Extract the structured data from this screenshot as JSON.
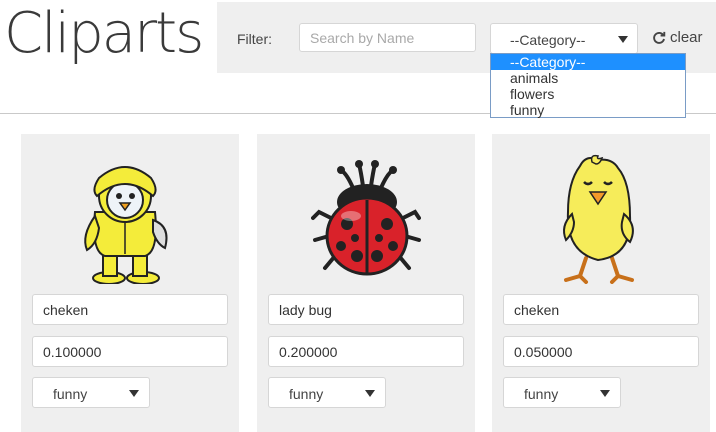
{
  "header": {
    "title": "Cliparts"
  },
  "filter": {
    "label": "Filter:",
    "search_placeholder": "Search by Name",
    "category_value": "--Category--",
    "clear_label": "clear"
  },
  "category_dropdown": {
    "options": [
      "--Category--",
      "animals",
      "flowers",
      "funny"
    ],
    "selected_index": 0
  },
  "cliparts": [
    {
      "icon": "chick-raincoat-icon",
      "name": "cheken",
      "price": "0.100000",
      "category": "funny"
    },
    {
      "icon": "ladybug-icon",
      "name": "lady bug",
      "price": "0.200000",
      "category": "funny"
    },
    {
      "icon": "chick-icon",
      "name": "cheken",
      "price": "0.050000",
      "category": "funny"
    }
  ]
}
